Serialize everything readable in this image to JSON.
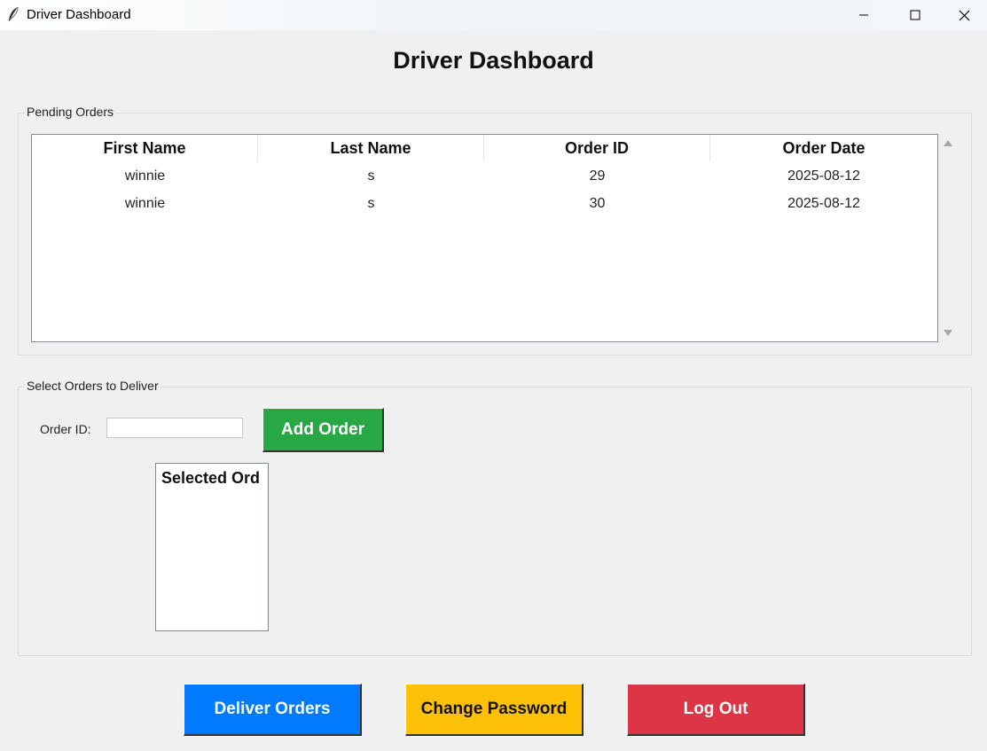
{
  "window": {
    "title": "Driver Dashboard",
    "app_icon": "feather-icon"
  },
  "page": {
    "title": "Driver Dashboard"
  },
  "pending_orders": {
    "group_label": "Pending Orders",
    "columns": [
      "First Name",
      "Last Name",
      "Order ID",
      "Order Date"
    ],
    "rows": [
      [
        "winnie",
        "s",
        "29",
        "2025-08-12"
      ],
      [
        "winnie",
        "s",
        "30",
        "2025-08-12"
      ]
    ]
  },
  "select_orders": {
    "group_label": "Select Orders to Deliver",
    "order_id_label": "Order ID:",
    "order_id_value": "",
    "add_button": "Add Order",
    "selected_header": "Selected Ord"
  },
  "actions": {
    "deliver": "Deliver Orders",
    "change_password": "Change Password",
    "logout": "Log Out"
  },
  "colors": {
    "add": "#28a745",
    "deliver": "#007bff",
    "change_password": "#ffc107",
    "logout": "#dc3545"
  }
}
